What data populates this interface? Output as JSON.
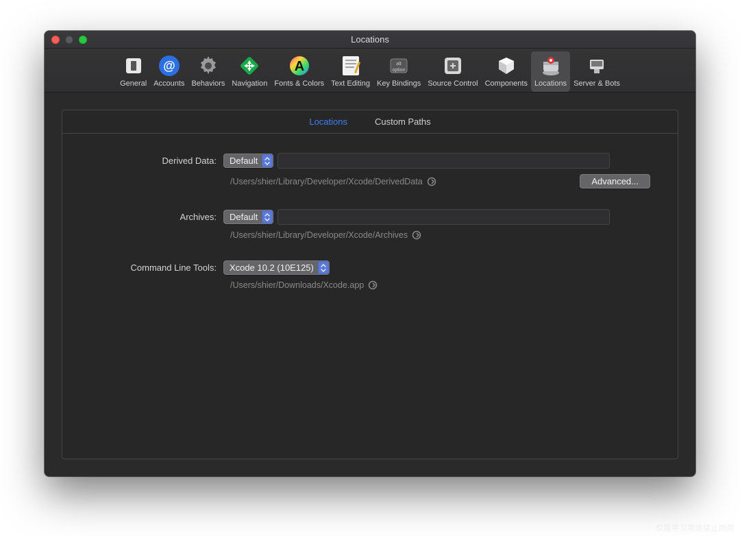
{
  "window": {
    "title": "Locations"
  },
  "toolbar": {
    "tabs": [
      {
        "label": "General"
      },
      {
        "label": "Accounts"
      },
      {
        "label": "Behaviors"
      },
      {
        "label": "Navigation"
      },
      {
        "label": "Fonts & Colors"
      },
      {
        "label": "Text Editing"
      },
      {
        "label": "Key Bindings"
      },
      {
        "label": "Source Control"
      },
      {
        "label": "Components"
      },
      {
        "label": "Locations"
      },
      {
        "label": "Server & Bots"
      }
    ],
    "selected_index": 9
  },
  "segments": {
    "locations": "Locations",
    "custom_paths": "Custom Paths",
    "active": "locations"
  },
  "form": {
    "derived_data": {
      "label": "Derived Data:",
      "value": "Default",
      "path": "/Users/shier/Library/Developer/Xcode/DerivedData",
      "advanced_label": "Advanced..."
    },
    "archives": {
      "label": "Archives:",
      "value": "Default",
      "path": "/Users/shier/Library/Developer/Xcode/Archives"
    },
    "cli_tools": {
      "label": "Command Line Tools:",
      "value": "Xcode 10.2 (10E125)",
      "path": "/Users/shier/Downloads/Xcode.app"
    }
  },
  "watermark": "仅限学习用途禁止商用"
}
